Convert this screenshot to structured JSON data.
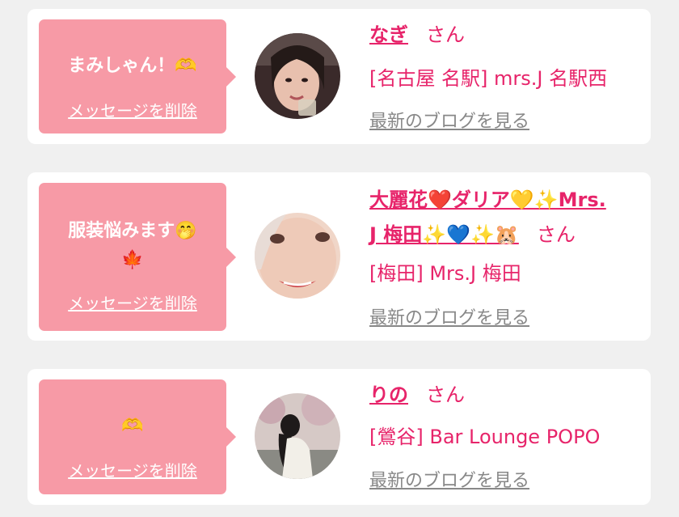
{
  "items": [
    {
      "message": "まみしゃん！🫶",
      "delete_label": "メッセージを削除",
      "name": "なぎ",
      "honorific": "さん",
      "shop": "[名古屋 名駅] mrs.J 名駅西",
      "blog_label": "最新のブログを見る"
    },
    {
      "message": "服装悩みます🤭",
      "message_line2": "🍁",
      "delete_label": "メッセージを削除",
      "name_line1": "大麗花❤️ダリア💛✨Mrs.",
      "name_line2": "J 梅田✨💙✨🐹",
      "honorific": "さん",
      "shop": "[梅田] Mrs.J 梅田",
      "blog_label": "最新のブログを見る"
    },
    {
      "message": "🫶",
      "delete_label": "メッセージを削除",
      "name": "りの",
      "honorific": "さん",
      "shop": "[鶯谷] Bar Lounge POPO",
      "blog_label": "最新のブログを見る"
    }
  ],
  "colors": {
    "page_bg": "#f0f0f0",
    "card_bg": "#ffffff",
    "bubble_bg": "#f79aa6",
    "accent": "#e7246a",
    "link_gray": "#888888"
  },
  "icons": {
    "avatar_icon": "user-photo"
  }
}
